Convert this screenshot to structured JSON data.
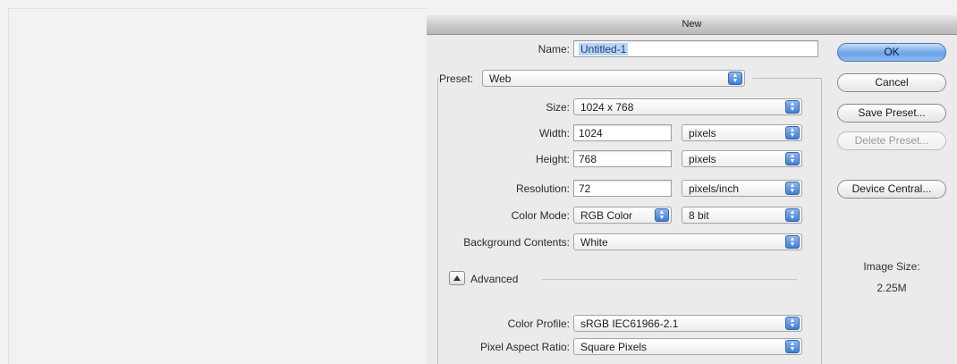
{
  "window": {
    "title": "New"
  },
  "name": {
    "label": "Name:",
    "value": "Untitled-1"
  },
  "preset": {
    "label": "Preset:",
    "value": "Web",
    "stepper_icon": "updown-arrows-icon"
  },
  "size": {
    "label": "Size:",
    "value": "1024 x 768"
  },
  "width": {
    "label": "Width:",
    "value": "1024",
    "unit": "pixels"
  },
  "height": {
    "label": "Height:",
    "value": "768",
    "unit": "pixels"
  },
  "resolution": {
    "label": "Resolution:",
    "value": "72",
    "unit": "pixels/inch"
  },
  "color_mode": {
    "label": "Color Mode:",
    "value": "RGB Color",
    "depth": "8 bit"
  },
  "background_contents": {
    "label": "Background Contents:",
    "value": "White"
  },
  "advanced": {
    "label": "Advanced"
  },
  "color_profile": {
    "label": "Color Profile:",
    "value": "sRGB IEC61966-2.1"
  },
  "pixel_aspect_ratio": {
    "label": "Pixel Aspect Ratio:",
    "value": "Square Pixels"
  },
  "buttons": {
    "ok": "OK",
    "cancel": "Cancel",
    "save_preset": "Save Preset...",
    "delete_preset": "Delete Preset...",
    "device_central": "Device Central..."
  },
  "image_size": {
    "label": "Image Size:",
    "value": "2.25M"
  },
  "colors": {
    "accent": "#6aa2e6",
    "stepper": "#3d7ed6",
    "selection": "#b9d4f4"
  }
}
